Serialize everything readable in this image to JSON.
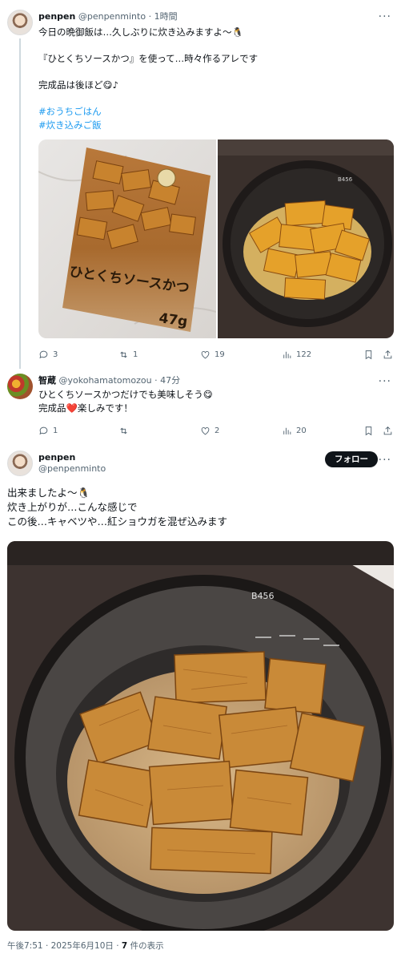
{
  "post1": {
    "name": "penpen",
    "handle": "@penpenminto",
    "time": "1時間",
    "lines": [
      "今日の晩御飯は…久しぶりに炊き込みますよ〜🐧",
      "『ひとくちソースかつ』を使って…時々作るアレです",
      "完成品は後ほど😋♪"
    ],
    "hashtags": [
      "#おうちごはん",
      "#炊き込みご飯"
    ],
    "package_text": "ひとくちソースかつ",
    "package_weight": "47g",
    "cooker_model": "B456",
    "stats": {
      "replies": "3",
      "reposts": "1",
      "likes": "19",
      "views": "122"
    }
  },
  "reply": {
    "name": "智蔵",
    "handle": "@yokohamatomozou",
    "time": "47分",
    "lines": [
      "ひとくちソースかつだけでも美味しそう😋",
      "完成品❤️楽しみです！"
    ],
    "stats": {
      "replies": "1",
      "reposts": "",
      "likes": "2",
      "views": "20"
    }
  },
  "post2": {
    "name": "penpen",
    "handle": "@penpenminto",
    "follow_label": "フォロー",
    "lines": [
      "出来ましたよ〜🐧",
      "炊き上がりが…こんな感じで",
      "この後…キャベツや…紅ショウガを混ぜ込みます"
    ],
    "cooker_model": "B456",
    "meta": {
      "time": "午後7:51",
      "date": "2025年6月10日",
      "views_count": "7",
      "views_label": "件の表示"
    }
  }
}
